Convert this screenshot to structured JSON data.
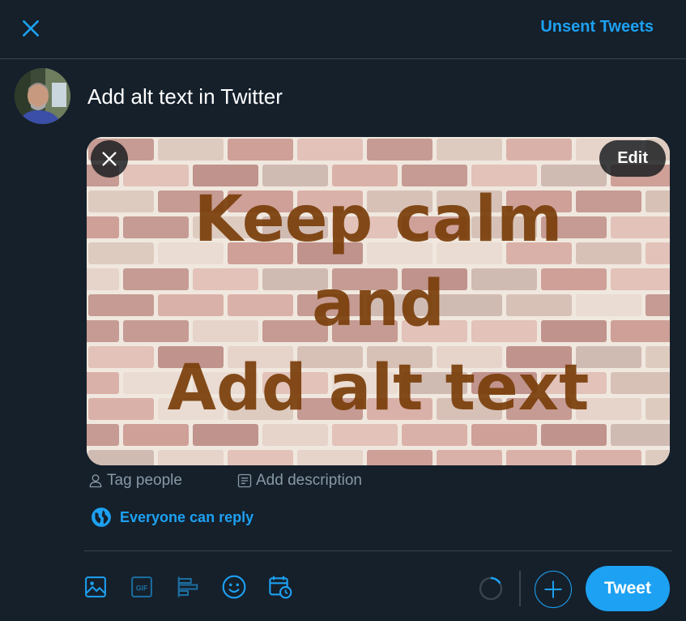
{
  "header": {
    "close_icon": "close-icon",
    "unsent_label": "Unsent Tweets"
  },
  "composer": {
    "avatar_icon": "user-avatar",
    "text": "Add alt text in Twitter"
  },
  "media": {
    "image_lines": [
      "Keep calm",
      "and",
      "Add alt text"
    ],
    "edit_label": "Edit",
    "remove_icon": "close-icon"
  },
  "media_actions": {
    "tag_people_label": "Tag people",
    "add_description_label": "Add description"
  },
  "reply_setting": {
    "label": "Everyone can reply",
    "icon": "globe-icon"
  },
  "toolbar": {
    "icons": [
      "image-icon",
      "gif-icon",
      "poll-icon",
      "emoji-icon",
      "schedule-icon"
    ],
    "gif_text": "GIF",
    "tweet_label": "Tweet"
  },
  "colors": {
    "background": "#15202b",
    "accent": "#1da1f2",
    "muted": "#8899a6",
    "border": "#38444d",
    "image_text": "#7a3e0a"
  }
}
